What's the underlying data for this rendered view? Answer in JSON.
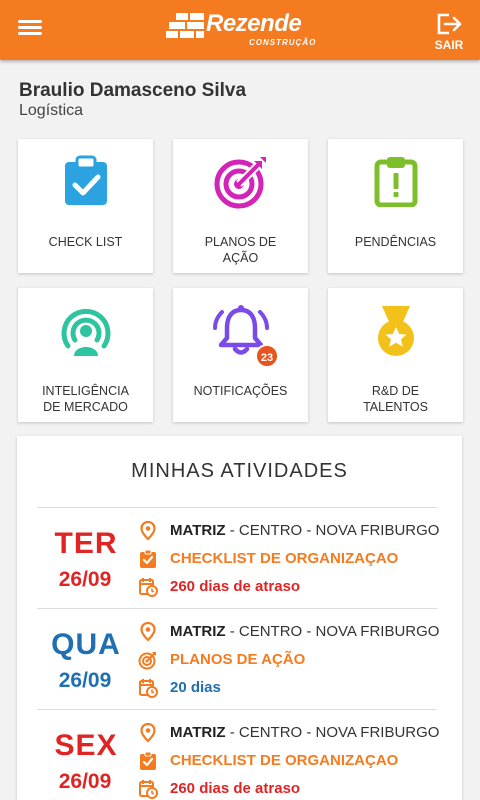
{
  "header": {
    "brand_name": "Rezende",
    "brand_sub": "CONSTRUÇÃO",
    "logout_label": "SAIR",
    "accent": "#f47b20"
  },
  "user": {
    "name": "Braulio Damasceno Silva",
    "department": "Logística"
  },
  "tiles": [
    {
      "label": "CHECK LIST",
      "icon": "clipboard-check-icon",
      "color": "#2aa3e0"
    },
    {
      "label": "PLANOS DE AÇÃO",
      "icon": "target-icon",
      "color": "#d324b8"
    },
    {
      "label": "PENDÊNCIAS",
      "icon": "clipboard-alert-icon",
      "color": "#7cbf2a"
    },
    {
      "label": "INTELIGÊNCIA DE MERCADO",
      "icon": "broadcast-user-icon",
      "color": "#2ec4a0"
    },
    {
      "label": "NOTIFICAÇÕES",
      "icon": "bell-icon",
      "color": "#7a4be8",
      "badge": "23"
    },
    {
      "label": "R&D DE TALENTOS",
      "icon": "medal-icon",
      "color": "#f2c21a"
    }
  ],
  "activities": {
    "title": "MINHAS ATIVIDADES",
    "items": [
      {
        "dow": "TER",
        "date": "26/09",
        "day_color": "#e02424",
        "place_bold": "MATRIZ",
        "place_rest": " - CENTRO - NOVA FRIBURGO",
        "task": "CHECKLIST DE ORGANIZAÇAO",
        "task_icon": "checklist-icon",
        "deadline": "260 dias de atraso",
        "deadline_color": "#e02424"
      },
      {
        "dow": "QUA",
        "date": "26/09",
        "day_color": "#1f6fb2",
        "place_bold": "MATRIZ",
        "place_rest": " - CENTRO - NOVA FRIBURGO",
        "task": "PLANOS DE AÇÃO",
        "task_icon": "target-icon",
        "deadline": "20 dias",
        "deadline_color": "#1f6fb2"
      },
      {
        "dow": "SEX",
        "date": "26/09",
        "day_color": "#e02424",
        "place_bold": "MATRIZ",
        "place_rest": " - CENTRO - NOVA FRIBURGO",
        "task": "CHECKLIST DE ORGANIZAÇAO",
        "task_icon": "checklist-icon",
        "deadline": "260 dias de atraso",
        "deadline_color": "#e02424"
      }
    ]
  }
}
